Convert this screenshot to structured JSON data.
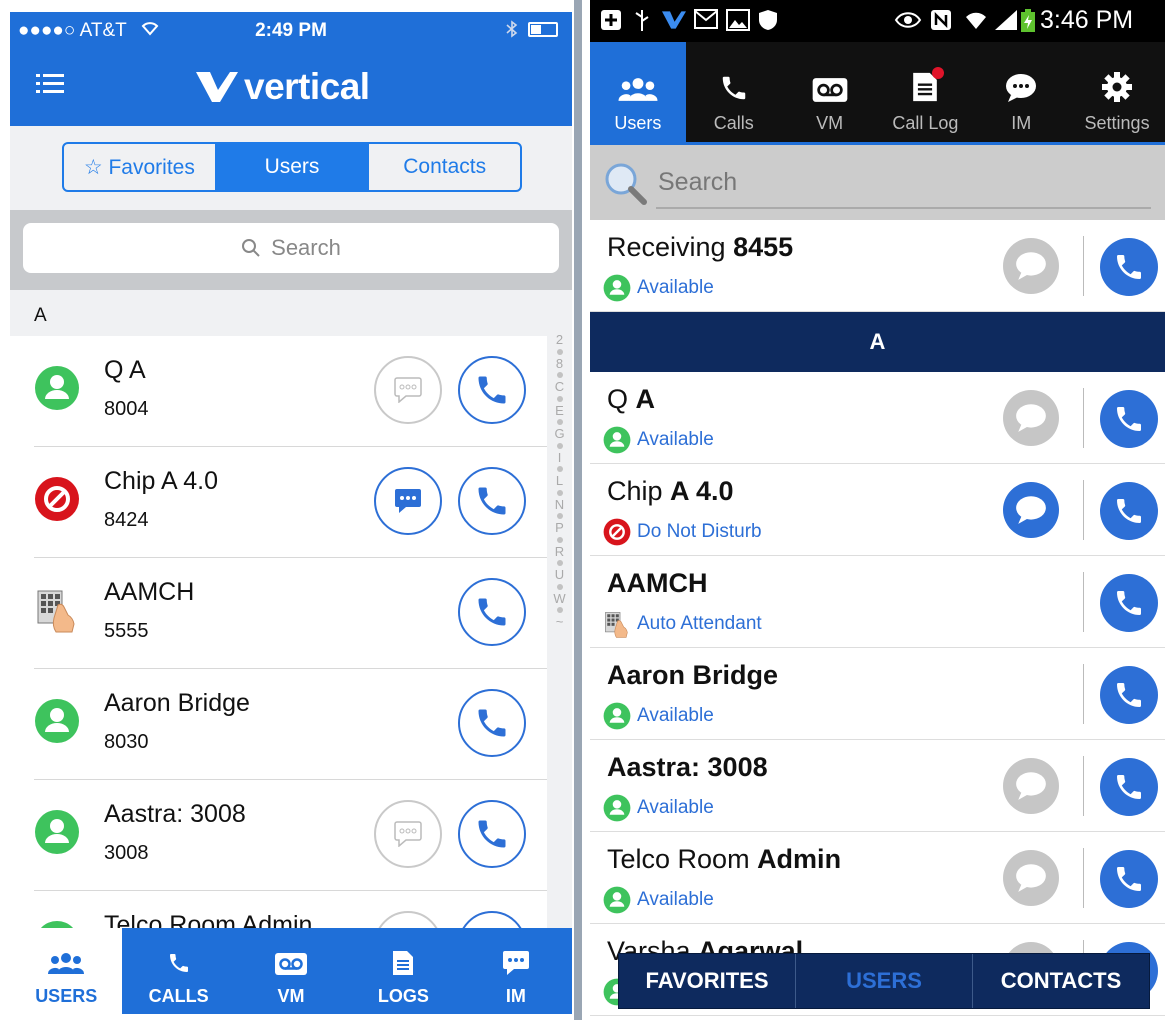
{
  "colors": {
    "ios_blue": "#1f6fd8",
    "available_green": "#3ec35d",
    "dnd_red": "#d8141c",
    "android_navy": "#0e2a5e",
    "call_blue": "#2d6fd6"
  },
  "ios": {
    "status": {
      "carrier": "●●●●○ AT&T",
      "time": "2:49 PM"
    },
    "brand": "vertical",
    "segments": {
      "favorites": "☆ Favorites",
      "users": "Users",
      "contacts": "Contacts"
    },
    "search_placeholder": "Search",
    "section_letter": "A",
    "index_letters": [
      "2",
      "8",
      "C",
      "E",
      "G",
      "I",
      "L",
      "N",
      "P",
      "R",
      "U",
      "W",
      "~"
    ],
    "rows": [
      {
        "name": "Q A",
        "ext": "8004",
        "presence": "available",
        "chat": "inactive"
      },
      {
        "name": "Chip A 4.0",
        "ext": "8424",
        "presence": "dnd",
        "chat": "active"
      },
      {
        "name": "AAMCH",
        "ext": "5555",
        "presence": "auto-attendant",
        "chat": "none"
      },
      {
        "name": "Aaron Bridge",
        "ext": "8030",
        "presence": "available",
        "chat": "none"
      },
      {
        "name": "Aastra: 3008",
        "ext": "3008",
        "presence": "available",
        "chat": "inactive"
      },
      {
        "name": "Telco Room Admin",
        "ext": "",
        "presence": "available",
        "chat": "inactive"
      }
    ],
    "tabs": {
      "users": "USERS",
      "calls": "CALLS",
      "vm": "VM",
      "logs": "LOGS",
      "im": "IM"
    }
  },
  "android": {
    "status": {
      "time": "3:46 PM"
    },
    "tabs": {
      "users": "Users",
      "calls": "Calls",
      "vm": "VM",
      "call_log": "Call Log",
      "im": "IM",
      "settings": "Settings"
    },
    "search_placeholder": "Search",
    "top_row": {
      "name_plain": "Receiving ",
      "name_bold": "8455",
      "status": "Available"
    },
    "section_letter": "A",
    "rows": [
      {
        "name_plain": "Q ",
        "name_bold": "A",
        "status": "Available",
        "presence": "available",
        "chat": "inactive"
      },
      {
        "name_plain": "Chip ",
        "name_bold": "A 4.0",
        "status": "Do Not Disturb",
        "presence": "dnd",
        "chat": "active"
      },
      {
        "name_plain": "",
        "name_bold": "AAMCH",
        "status": "Auto Attendant",
        "presence": "auto-attendant",
        "chat": "none"
      },
      {
        "name_plain": "",
        "name_bold": "Aaron Bridge",
        "status": "Available",
        "presence": "available",
        "chat": "none"
      },
      {
        "name_plain": "",
        "name_bold": "Aastra: 3008",
        "status": "Available",
        "presence": "available",
        "chat": "inactive"
      },
      {
        "name_plain": "Telco Room ",
        "name_bold": "Admin",
        "status": "Available",
        "presence": "available",
        "chat": "inactive"
      },
      {
        "name_plain": "Varsha ",
        "name_bold": "Agarwal",
        "status": "Available",
        "presence": "available",
        "chat": "inactive"
      }
    ],
    "bottom": {
      "favorites": "FAVORITES",
      "users": "USERS",
      "contacts": "CONTACTS"
    }
  }
}
